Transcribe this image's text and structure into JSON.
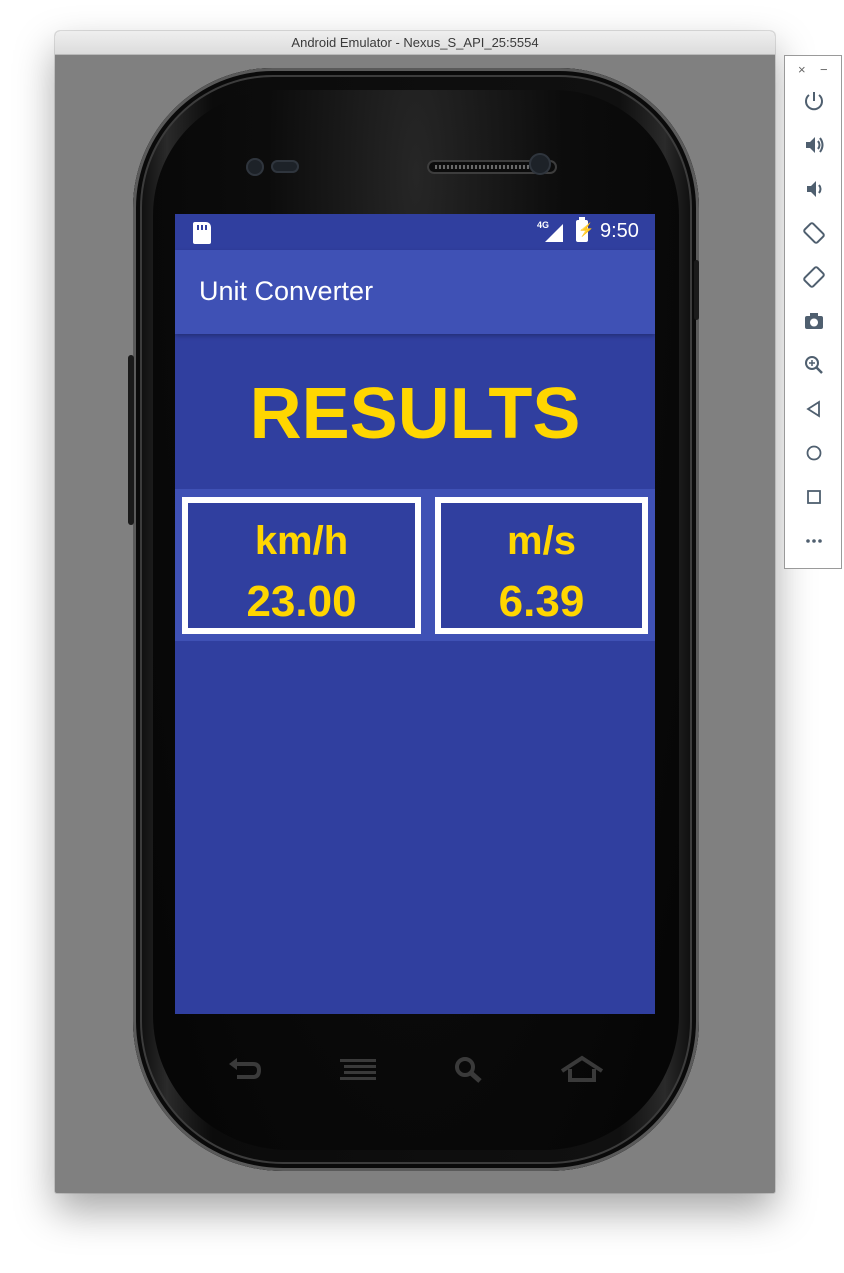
{
  "window": {
    "title": "Android Emulator - Nexus_S_API_25:5554"
  },
  "status_bar": {
    "network": "4G",
    "battery_glyph": "⚡",
    "time": "9:50"
  },
  "app_bar": {
    "title": "Unit Converter"
  },
  "main": {
    "heading": "RESULTS",
    "cards": [
      {
        "unit": "km/h",
        "value": "23.00"
      },
      {
        "unit": "m/s",
        "value": "6.39"
      }
    ]
  },
  "toolbar": {
    "close": "×",
    "minimize": "−",
    "buttons": [
      "power-icon",
      "volume-up-icon",
      "volume-down-icon",
      "rotate-left-icon",
      "rotate-right-icon",
      "camera-icon",
      "zoom-icon",
      "back-icon",
      "home-icon",
      "overview-icon",
      "more-icon"
    ]
  },
  "hardware_nav": [
    "back-icon",
    "menu-icon",
    "search-icon",
    "home-icon"
  ],
  "colors": {
    "primary": "#3f51b5",
    "primary_dark": "#303f9f",
    "accent_text": "#ffd600"
  }
}
